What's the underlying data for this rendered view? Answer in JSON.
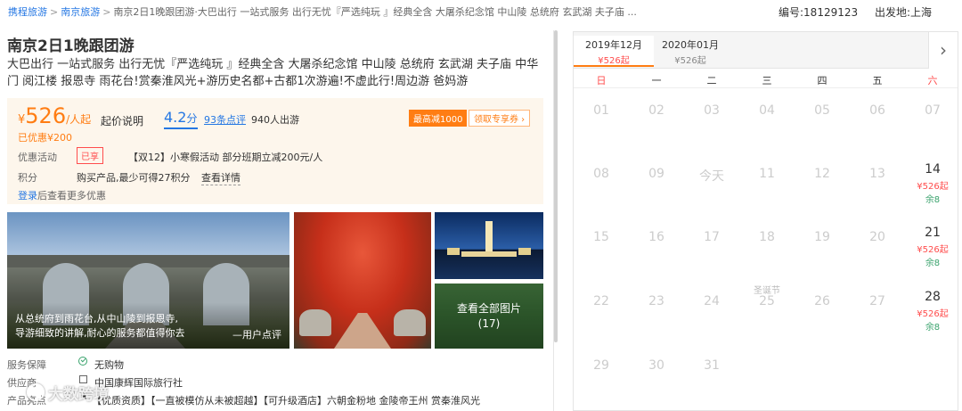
{
  "breadcrumb": {
    "home": "携程旅游",
    "city": "南京旅游",
    "current": "南京2日1晚跟团游·大巴出行 一站式服务 出行无忧『严选纯玩 』经典全含 大屠杀纪念馆 中山陵 总统府 玄武湖 夫子庙 ..."
  },
  "code": "编号:18129123",
  "departure": "出发地:上海",
  "title": "南京2日1晚跟团游",
  "subtitle": "大巴出行 一站式服务 出行无忧『严选纯玩 』经典全含 大屠杀纪念馆 中山陵 总统府 玄武湖 夫子庙 中华门 阅江楼 报恩寺 雨花台!赏秦淮风光+游历史名都+古都1次游遍!不虚此行!周边游 爸妈游",
  "price": {
    "currency": "¥",
    "amount": "526",
    "unit": "/人起",
    "note": "起价说明",
    "saved": "已优惠¥200",
    "score": "4.2",
    "score_unit": "分",
    "reviews": "93条点评",
    "visitors": "940人出游",
    "max_discount": "最高减1000",
    "coupon_button": "领取专享券 ›"
  },
  "promo": {
    "label": "优惠活动",
    "badge": "已享",
    "text": "【双12】小寒假活动 部分班期立减200元/人"
  },
  "points": {
    "label": "积分",
    "text": "购买产品,最少可得27积分",
    "link": "查看详情"
  },
  "login": {
    "link": "登录",
    "text": "后查看更多优惠"
  },
  "gallery": {
    "quote_line1": "从总统府到雨花台,从中山陵到报恩寺,",
    "quote_line2": "导游细致的讲解,耐心的服务都值得你去",
    "quote_by": "—用户点评",
    "view_all": "查看全部图片",
    "count": "(17)"
  },
  "info": [
    {
      "label": "服务保障",
      "value": "无购物"
    },
    {
      "label": "供应商",
      "value": "中国康辉国际旅行社"
    },
    {
      "label": "产品亮点",
      "value": "【优质资质】【一直被模仿从未被超越】【可升级酒店】六朝金粉地 金陵帝王州 赏秦淮风光"
    }
  ],
  "watermark": "大数跨境",
  "calendar": {
    "months": [
      {
        "label": "2019年12月",
        "price": "¥526起",
        "active": true
      },
      {
        "label": "2020年01月",
        "price": "¥526起",
        "active": false
      }
    ],
    "next_arrow": "›",
    "weekdays": [
      "日",
      "一",
      "二",
      "三",
      "四",
      "五",
      "六"
    ],
    "weeks": [
      [
        {
          "d": "01"
        },
        {
          "d": "02"
        },
        {
          "d": "03"
        },
        {
          "d": "04"
        },
        {
          "d": "05"
        },
        {
          "d": "06"
        },
        {
          "d": "07"
        }
      ],
      [
        {
          "d": "08"
        },
        {
          "d": "09"
        },
        {
          "d": "今天"
        },
        {
          "d": "11"
        },
        {
          "d": "12"
        },
        {
          "d": "13"
        },
        {
          "d": "14",
          "price": "¥526起",
          "left": "余8"
        }
      ],
      [
        {
          "d": "15"
        },
        {
          "d": "16"
        },
        {
          "d": "17"
        },
        {
          "d": "18"
        },
        {
          "d": "19"
        },
        {
          "d": "20"
        },
        {
          "d": "21",
          "price": "¥526起",
          "left": "余8"
        }
      ],
      [
        {
          "d": "22"
        },
        {
          "d": "23"
        },
        {
          "d": "24"
        },
        {
          "d": "25",
          "festival": "圣诞节"
        },
        {
          "d": "26"
        },
        {
          "d": "27"
        },
        {
          "d": "28",
          "price": "¥526起",
          "left": "余8"
        }
      ],
      [
        {
          "d": "29"
        },
        {
          "d": "30"
        },
        {
          "d": "31"
        }
      ]
    ]
  }
}
